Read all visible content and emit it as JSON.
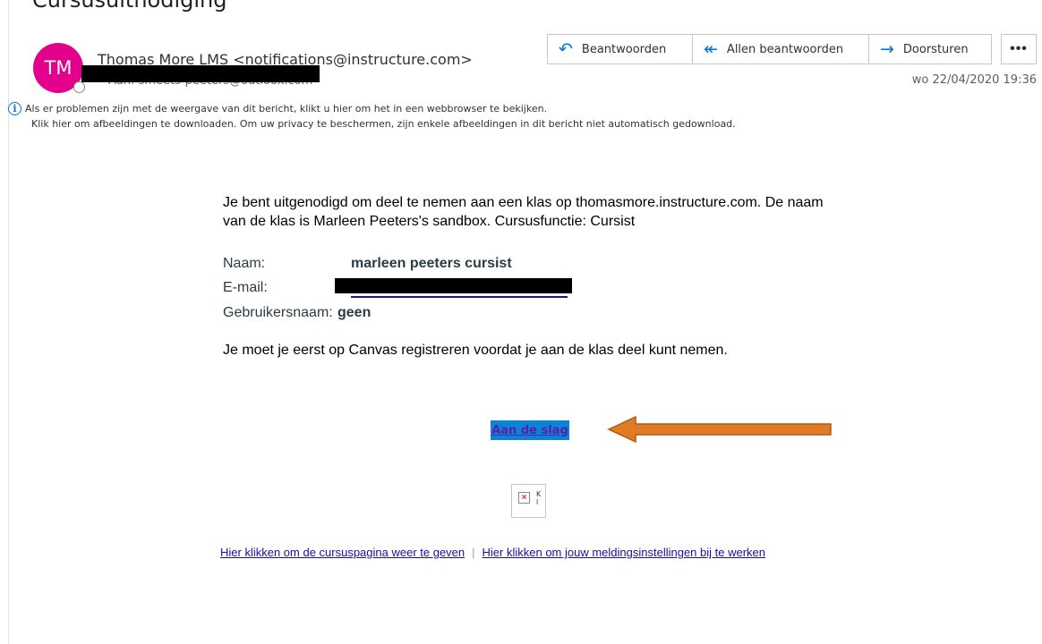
{
  "email": {
    "subject": "Cursusuitnodiging",
    "avatar_initials": "TM",
    "avatar_color": "#e3008c",
    "sender": "Thomas More LMS <notifications@instructure.com>",
    "recipient": "Aan: smeets-peeters@outlook.com",
    "date": "wo 22/04/2020 19:36"
  },
  "actions": {
    "reply_label": "Beantwoorden",
    "reply_all_label": "Allen beantwoorden",
    "forward_label": "Doorsturen",
    "more_label": "•••"
  },
  "infobar": {
    "icon": "info-icon",
    "line1": "Als er problemen zijn met de weergave van dit bericht, klikt u hier om het in een webbrowser te bekijken.",
    "line2": "Klik hier om afbeeldingen te downloaden. Om uw privacy te beschermen, zijn enkele afbeeldingen in dit bericht niet automatisch gedownload."
  },
  "message": {
    "intro": "Je bent uitgenodigd om deel te nemen aan een klas op thomasmore.instructure.com. De naam van de klas is Marleen Peeters's sandbox. Cursusfunctie: Cursist",
    "fields": {
      "name_label": "Naam:",
      "name_value": "marleen peeters cursist",
      "email_label": "E-mail:",
      "username_label": "Gebruikersnaam:",
      "username_value": "geen"
    },
    "register_text": "Je moet je eerst op Canvas registreren voordat je aan de klas deel kunt nemen.",
    "cta_label": "Aan de slag",
    "cta_bg": "#0a84d6",
    "arrow_color": "#e07b24",
    "broken_image_text": "K\nl"
  },
  "footer": {
    "course_link": "Hier klikken om de cursuspagina weer te geven",
    "separator": "|",
    "settings_link": "Hier klikken om jouw meldingsinstellingen bij te werken"
  }
}
